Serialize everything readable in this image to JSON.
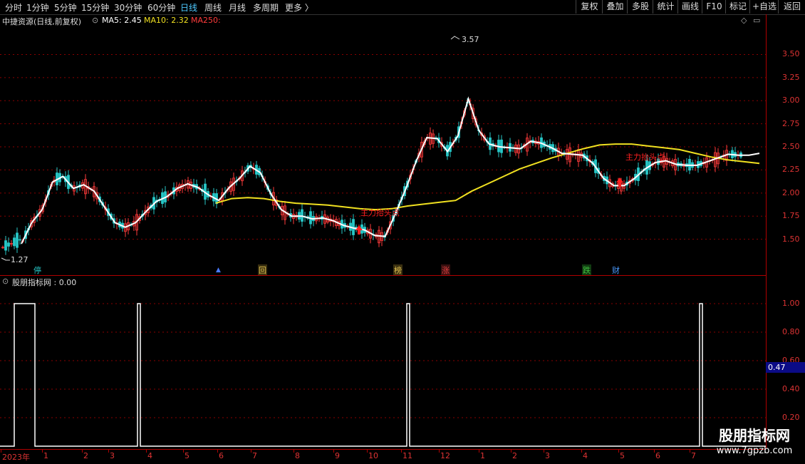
{
  "toolbar": {
    "timeframes": [
      "分时",
      "1分钟",
      "5分钟",
      "15分钟",
      "30分钟",
      "60分钟",
      "日线",
      "周线",
      "月线",
      "多周期",
      "更多"
    ],
    "active_timeframe": "日线",
    "right_buttons": [
      "复权",
      "叠加",
      "多股",
      "统计",
      "画线",
      "F10",
      "标记",
      "+自选",
      "返回"
    ]
  },
  "chart_header": {
    "title": "中捷资源(日线,前复权)",
    "ma5_label": "MA5: 2.45",
    "ma10_label": "MA10: 2.32",
    "ma250_label": "MA250:"
  },
  "indicator_header": {
    "title": "股朋指标网 : 0.00"
  },
  "price_axis": {
    "ticks": [
      "3.50",
      "3.25",
      "3.00",
      "2.75",
      "2.50",
      "2.25",
      "2.00",
      "1.75",
      "1.50"
    ]
  },
  "indicator_axis": {
    "ticks": [
      "1.00",
      "0.80",
      "0.60",
      "0.40",
      "0.20"
    ],
    "cursor_value": "0.47"
  },
  "time_axis": {
    "labels": [
      "2023年",
      "1",
      "2",
      "3",
      "4",
      "5",
      "6",
      "7",
      "8",
      "9",
      "10",
      "11",
      "12",
      "1",
      "2",
      "3",
      "4",
      "5",
      "6",
      "7"
    ]
  },
  "annotations": {
    "high": "3.57",
    "low": "1.27",
    "signal_text_1": "主力抬头点",
    "signal_text_2": "主力抬头点"
  },
  "badges": [
    {
      "text": "停",
      "color": "#27c7c7"
    },
    {
      "text": "▲",
      "color": "#4a7bff"
    },
    {
      "text": "回",
      "color": "#e0c050"
    },
    {
      "text": "榜",
      "color": "#e0c050"
    },
    {
      "text": "涨",
      "color": "#e04040"
    },
    {
      "text": "跌",
      "color": "#40c040"
    },
    {
      "text": "财",
      "color": "#4a9bff"
    }
  ],
  "watermark": {
    "name": "股朋指标网",
    "url": "www.7gpzb.com"
  },
  "colors": {
    "up": "#ff3b3b",
    "down": "#27c7c7",
    "ma5": "#ffffff",
    "ma250": "#f0e020",
    "grid": "#8b0000",
    "axis": "#b00000"
  },
  "chart_data": [
    {
      "type": "line",
      "title": "中捷资源(日线,前复权)",
      "series": [
        {
          "name": "MA5",
          "values": [
            1.45,
            1.68,
            1.82,
            2.12,
            2.18,
            2.05,
            2.09,
            2.02,
            1.85,
            1.68,
            1.63,
            1.68,
            1.8,
            1.91,
            1.96,
            2.05,
            2.1,
            2.06,
            1.98,
            1.92,
            2.06,
            2.16,
            2.29,
            2.22,
            1.99,
            1.82,
            1.75,
            1.75,
            1.72,
            1.73,
            1.7,
            1.65,
            1.62,
            1.6,
            1.54,
            1.53,
            1.78,
            2.05,
            2.35,
            2.6,
            2.59,
            2.45,
            2.62,
            3.02,
            2.68,
            2.53,
            2.5,
            2.49,
            2.48,
            2.56,
            2.54,
            2.49,
            2.43,
            2.42,
            2.41,
            2.32,
            2.16,
            2.08,
            2.08,
            2.16,
            2.26,
            2.33,
            2.35,
            2.31,
            2.3,
            2.3,
            2.34,
            2.38,
            2.42,
            2.41,
            2.41,
            2.43
          ]
        },
        {
          "name": "MA250",
          "values": [
            1.89,
            1.94,
            1.95,
            1.94,
            1.91,
            1.89,
            1.88,
            1.87,
            1.85,
            1.83,
            1.82,
            1.83,
            1.86,
            1.88,
            1.9,
            1.92,
            2.02,
            2.1,
            2.18,
            2.26,
            2.32,
            2.38,
            2.43,
            2.48,
            2.52,
            2.53,
            2.53,
            2.51,
            2.49,
            2.47,
            2.43,
            2.39,
            2.36,
            2.34,
            2.32
          ]
        }
      ],
      "ylim": [
        1.25,
        3.65
      ],
      "high": 3.57,
      "low": 1.27
    },
    {
      "type": "line",
      "title": "股朋指标网",
      "series": [
        {
          "name": "股朋指标网",
          "values": [
            1,
            1,
            0,
            0,
            1,
            0,
            0,
            0,
            1,
            0,
            0,
            0,
            1,
            0
          ]
        }
      ],
      "ylim": [
        0,
        1.1
      ]
    }
  ]
}
